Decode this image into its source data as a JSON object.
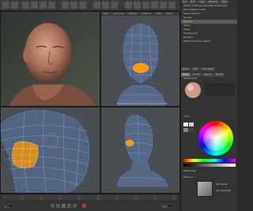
{
  "app": {
    "viewport_menus": [
      "View",
      "Cameras",
      "Display",
      "Options",
      "Filter",
      "Panel"
    ],
    "accent_color": "#ff9a00",
    "wireframe_color": "#4d8cff"
  },
  "viewport_top_right": {
    "label": "Perspective (camera: mask), no key: Focus-Ansicht"
  },
  "object_manager": {
    "menus": [
      "File",
      "Edit",
      "View",
      "Objects",
      "Tags",
      "Bookmarks"
    ],
    "items": [
      {
        "label": "Strahl in Sehnen-Key-Wire Frame Pre"
      },
      {
        "label": "Pivot Rotation Edit"
      },
      {
        "label": "Setup Tutorial"
      },
      {
        "label": "Render"
      },
      {
        "label": "Gesicht"
      },
      {
        "label": "Setup"
      },
      {
        "label": "Lamp"
      },
      {
        "label": "Hintergrund"
      },
      {
        "label": "Kamera"
      },
      {
        "label": "Texture Environ Object"
      }
    ]
  },
  "attribute_manager": {
    "menus": [
      "Mode",
      "Edit",
      "User Data"
    ],
    "tabs": [
      "Basic",
      "Coord",
      "Object",
      "Phong",
      "Display",
      "Shading",
      "Tags",
      "Layer"
    ],
    "material_name": "Fleischkopf"
  },
  "color_picker": {
    "label": "Color",
    "brightness_label": "Brightness",
    "texture_label": "Texture",
    "mix_label": "Mix Mode",
    "mix_strength_label": "Mix Strength"
  },
  "timeline": {
    "frame_start": "0 F",
    "frame_end": "90 F",
    "ticks": [
      "0",
      "10",
      "20",
      "30",
      "40",
      "50",
      "60",
      "70",
      "80",
      "90"
    ]
  },
  "coordinates": {
    "position_label": "Position",
    "size_label": "Size",
    "rotation_label": "Rotation",
    "x_value": "0 cm",
    "y_value": "0 cm",
    "z_value": "0 cm",
    "apply_label": "Apply"
  }
}
